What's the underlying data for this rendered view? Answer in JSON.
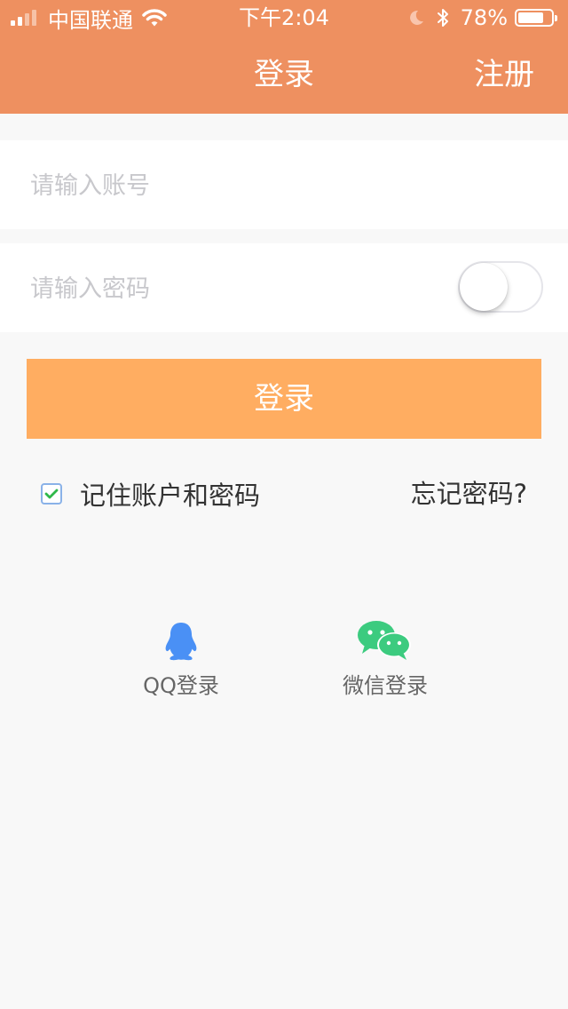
{
  "status_bar": {
    "carrier": "中国联通",
    "time": "下午2:04",
    "battery_percent": "78%",
    "battery_level": 0.78
  },
  "nav": {
    "title": "登录",
    "right_action": "注册",
    "color": "#ee9060"
  },
  "form": {
    "account_placeholder": "请输入账号",
    "password_placeholder": "请输入密码",
    "password_visible": false,
    "login_button": "登录",
    "button_color": "#ffad61",
    "remember_label": "记住账户和密码",
    "remember_checked": true,
    "forgot_link": "忘记密码?"
  },
  "social": {
    "qq": {
      "label": "QQ登录",
      "icon": "qq-penguin-icon",
      "color": "#4a90f5"
    },
    "wechat": {
      "label": "微信登录",
      "icon": "wechat-icon",
      "color": "#3ccb7f"
    }
  }
}
